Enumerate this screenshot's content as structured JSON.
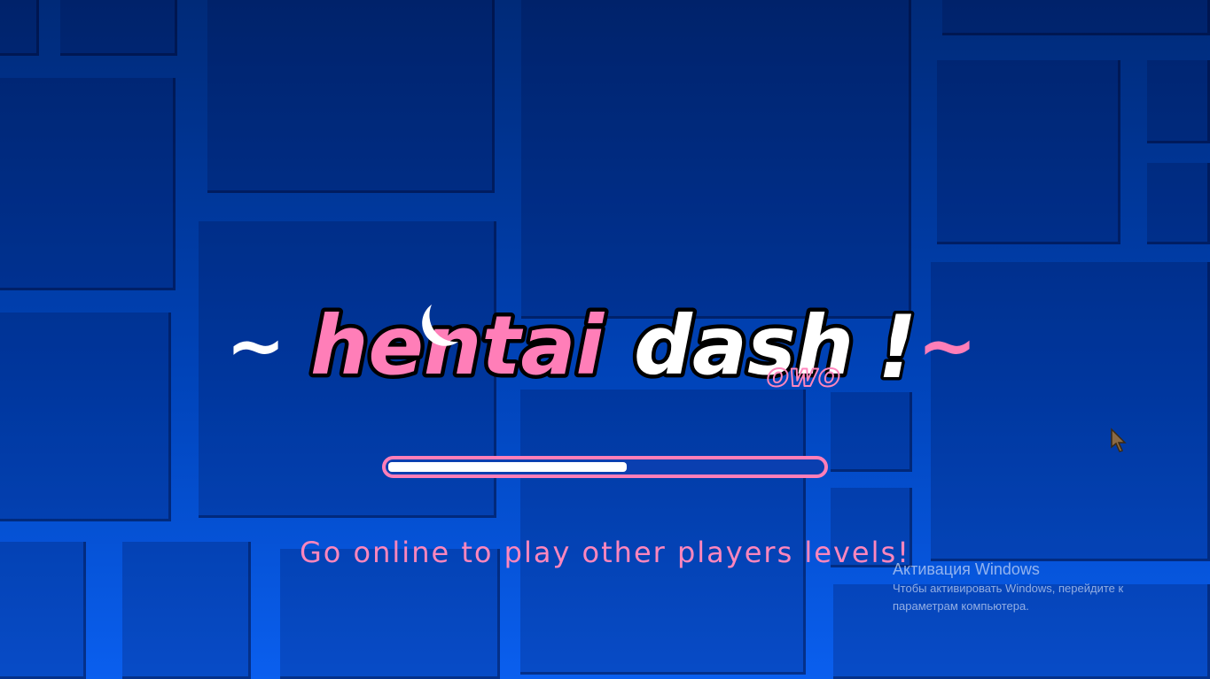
{
  "logo": {
    "tilde_left": "~",
    "word_pink": "hentai",
    "word_white": "dash",
    "exclaim": "!",
    "tilde_right": "~",
    "sub_text": "owo"
  },
  "progress": {
    "value": 0.55
  },
  "tip": {
    "text": "Go online to play other players levels!"
  },
  "watermark": {
    "title": "Активация Windows",
    "line1": "Чтобы активировать Windows, перейдите к",
    "line2": "параметрам компьютера."
  },
  "colors": {
    "accent_pink": "#ff7eb8",
    "background_blue": "#0043b8",
    "logo_white": "#ffffff",
    "logo_outline": "#000000"
  },
  "icons": {
    "cursor": "pointer-cursor-icon"
  }
}
